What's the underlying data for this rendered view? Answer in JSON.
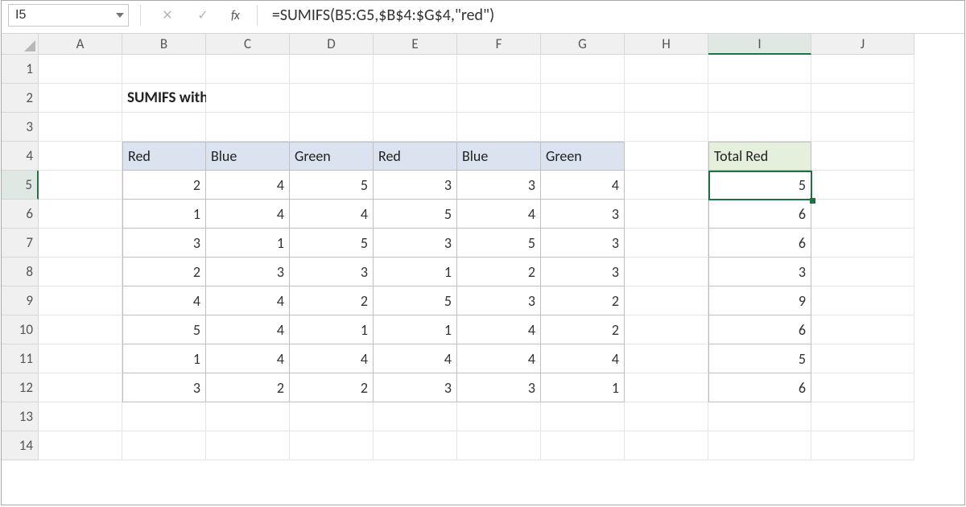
{
  "namebox": {
    "value": "I5"
  },
  "fx_label": "fx",
  "formula": "=SUMIFS(B5:G5,$B$4:$G$4,\"red\")",
  "col_headers": [
    "A",
    "B",
    "C",
    "D",
    "E",
    "F",
    "G",
    "H",
    "I",
    "J"
  ],
  "row_headers": [
    "1",
    "2",
    "3",
    "4",
    "5",
    "6",
    "7",
    "8",
    "9",
    "10",
    "11",
    "12",
    "13",
    "14"
  ],
  "selected_col": "I",
  "selected_row": "5",
  "title": "SUMIFS with horizontal range",
  "table_headers": [
    "Red",
    "Blue",
    "Green",
    "Red",
    "Blue",
    "Green"
  ],
  "result_header": "Total Red",
  "rows": [
    {
      "vals": [
        2,
        4,
        5,
        3,
        3,
        4
      ],
      "res": 5
    },
    {
      "vals": [
        1,
        4,
        4,
        5,
        4,
        3
      ],
      "res": 6
    },
    {
      "vals": [
        3,
        1,
        5,
        3,
        5,
        3
      ],
      "res": 6
    },
    {
      "vals": [
        2,
        3,
        3,
        1,
        2,
        3
      ],
      "res": 3
    },
    {
      "vals": [
        4,
        4,
        2,
        5,
        3,
        2
      ],
      "res": 9
    },
    {
      "vals": [
        5,
        4,
        1,
        1,
        4,
        2
      ],
      "res": 6
    },
    {
      "vals": [
        1,
        4,
        4,
        4,
        4,
        4
      ],
      "res": 5
    },
    {
      "vals": [
        3,
        2,
        2,
        3,
        3,
        1
      ],
      "res": 6
    }
  ],
  "chart_data": {
    "type": "table",
    "title": "SUMIFS with horizontal range",
    "columns": [
      "Red",
      "Blue",
      "Green",
      "Red",
      "Blue",
      "Green",
      "Total Red"
    ],
    "data": [
      [
        2,
        4,
        5,
        3,
        3,
        4,
        5
      ],
      [
        1,
        4,
        4,
        5,
        4,
        3,
        6
      ],
      [
        3,
        1,
        5,
        3,
        5,
        3,
        6
      ],
      [
        2,
        3,
        3,
        1,
        2,
        3,
        3
      ],
      [
        4,
        4,
        2,
        5,
        3,
        2,
        9
      ],
      [
        5,
        4,
        1,
        1,
        4,
        2,
        6
      ],
      [
        1,
        4,
        4,
        4,
        4,
        4,
        5
      ],
      [
        3,
        2,
        2,
        3,
        3,
        1,
        6
      ]
    ]
  },
  "btn": {
    "cancel": "✕",
    "confirm": "✓"
  }
}
